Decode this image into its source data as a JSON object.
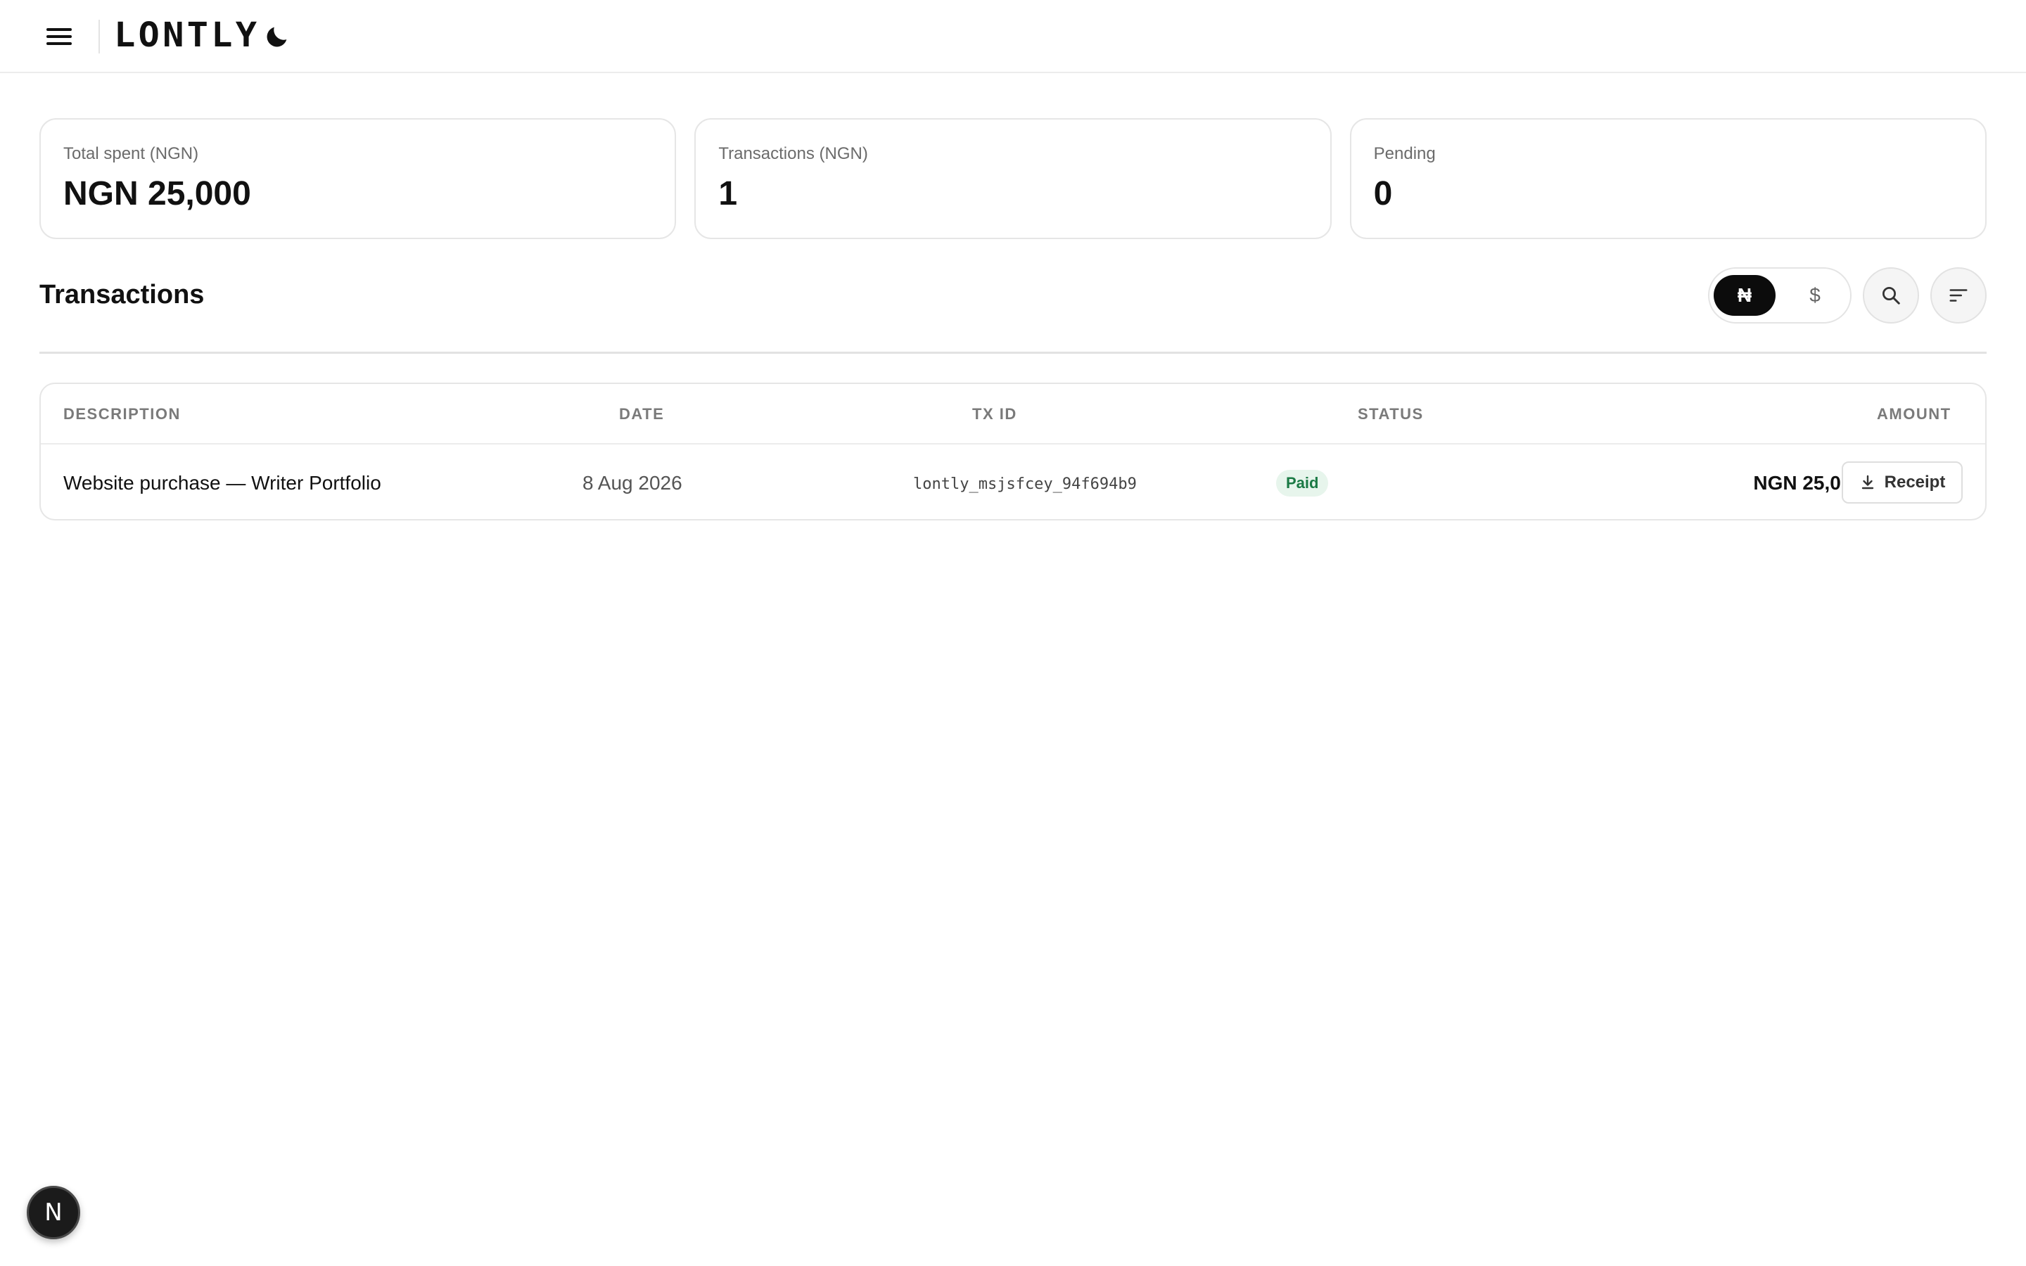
{
  "header": {
    "logo_text": "LONTLY",
    "menu_icon": "hamburger-menu-icon",
    "theme_icon": "moon-icon"
  },
  "stats": [
    {
      "label": "Total spent (NGN)",
      "value": "NGN 25,000"
    },
    {
      "label": "Transactions (NGN)",
      "value": "1"
    },
    {
      "label": "Pending",
      "value": "0"
    }
  ],
  "transactions": {
    "title": "Transactions",
    "currency_toggle": {
      "options": [
        "₦",
        "$"
      ],
      "selected": "₦"
    },
    "search_icon": "search-icon",
    "filter_icon": "sort-filter-icon",
    "columns": [
      "DESCRIPTION",
      "DATE",
      "TX ID",
      "STATUS",
      "AMOUNT"
    ],
    "rows": [
      {
        "description": "Website purchase — Writer Portfolio",
        "date": "8 Aug 2026",
        "tx_id": "lontly_msjsfcey_94f694b9",
        "status": "Paid",
        "amount": "NGN 25,000",
        "action_label": "Receipt"
      }
    ]
  },
  "fab": {
    "letter": "N"
  },
  "colors": {
    "accent": "#0c0c0c",
    "status_paid_bg": "#e7f5ec",
    "status_paid_text": "#1b7a45",
    "border": "#e6e6e6",
    "muted_text": "#6b6b6b"
  }
}
